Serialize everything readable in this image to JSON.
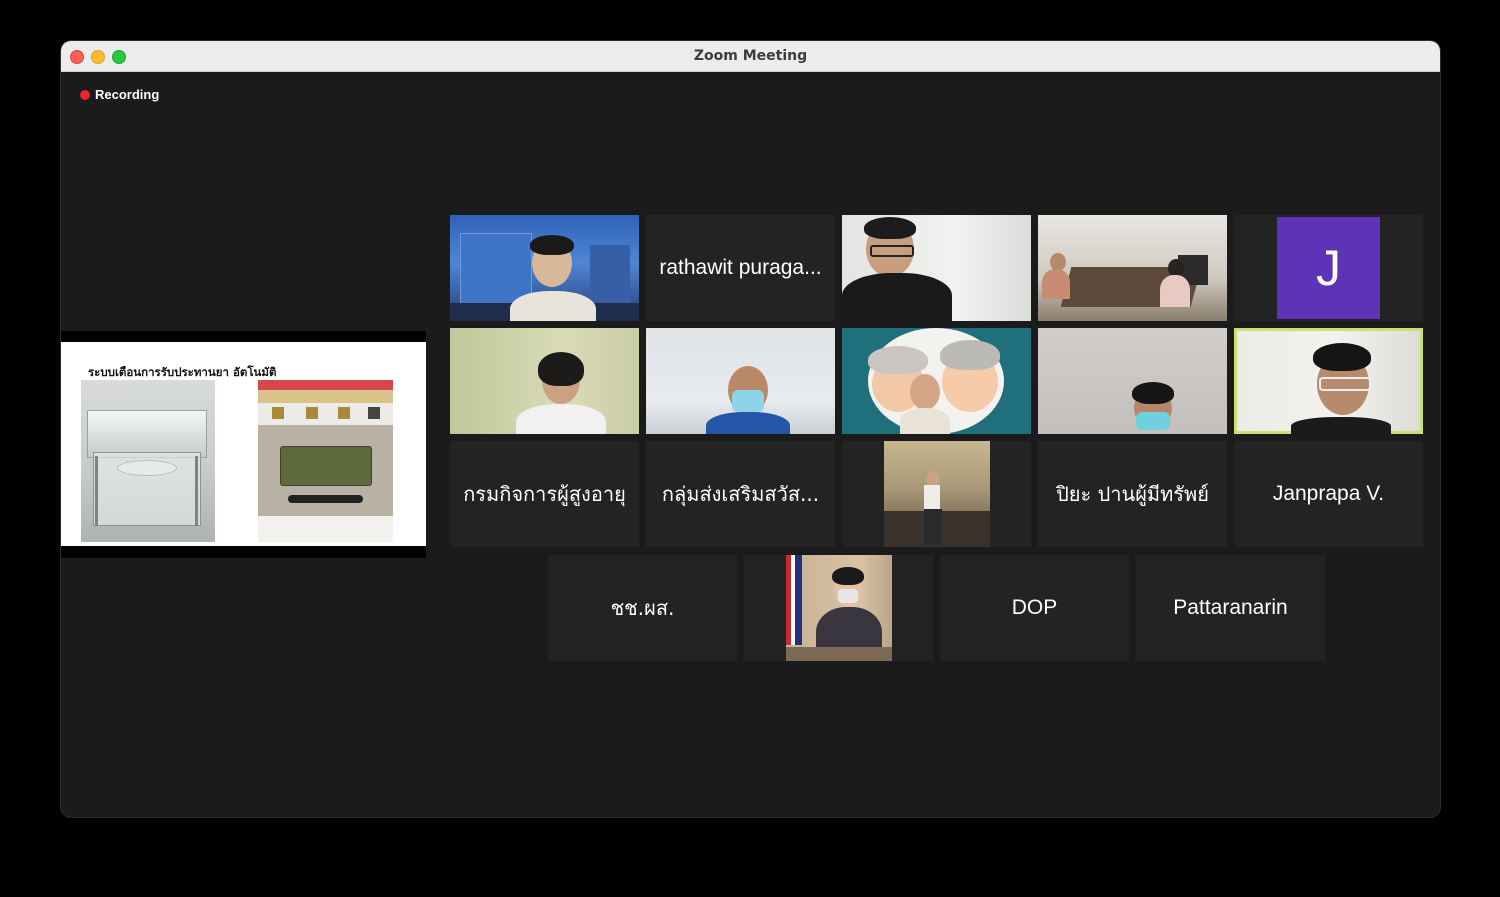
{
  "window": {
    "title": "Zoom Meeting",
    "recording_label": "Recording"
  },
  "shared_screen": {
    "slide_title": "ระบบเตือนการรับประทานยา อัตโนมัติ"
  },
  "participants": [
    {
      "id": "p1",
      "type": "video"
    },
    {
      "id": "p2",
      "type": "name",
      "name": "rathawit puraga..."
    },
    {
      "id": "p3",
      "type": "video"
    },
    {
      "id": "p4",
      "type": "video"
    },
    {
      "id": "p5",
      "type": "avatar",
      "initial": "J"
    },
    {
      "id": "p6",
      "type": "video"
    },
    {
      "id": "p7",
      "type": "video"
    },
    {
      "id": "p8",
      "type": "video"
    },
    {
      "id": "p9",
      "type": "video"
    },
    {
      "id": "p10",
      "type": "video",
      "active_speaker": true
    },
    {
      "id": "p11",
      "type": "name",
      "name": "กรมกิจการผู้สูงอายุ"
    },
    {
      "id": "p12",
      "type": "name",
      "name": "กลุ่มส่งเสริมสวัส..."
    },
    {
      "id": "p13",
      "type": "video"
    },
    {
      "id": "p14",
      "type": "name",
      "name": "ปิยะ ปานผู้มีทรัพย์"
    },
    {
      "id": "p15",
      "type": "name",
      "name": "Janprapa V."
    },
    {
      "id": "p16",
      "type": "name",
      "name": "ชช.ผส."
    },
    {
      "id": "p17",
      "type": "video"
    },
    {
      "id": "p18",
      "type": "name",
      "name": "DOP"
    },
    {
      "id": "p19",
      "type": "name",
      "name": "Pattaranarin"
    }
  ],
  "colors": {
    "recording_dot": "#e5262d",
    "active_speaker_border": "#c6e26f",
    "avatar_bg": "#5d33b8",
    "tile_bg": "#232323",
    "window_bg": "#1b1b1b"
  }
}
